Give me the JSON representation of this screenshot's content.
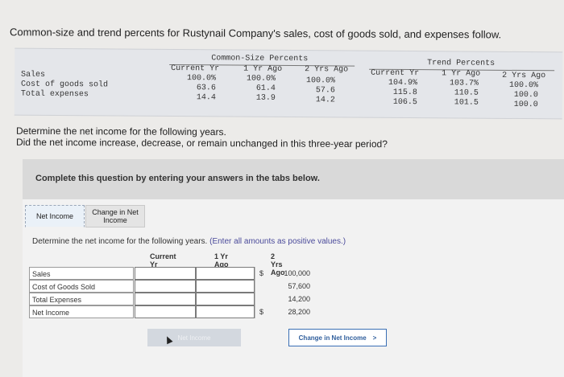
{
  "question": {
    "title": "Common-size and trend percents for Rustynail Company's sales, cost of goods sold, and expenses follow.",
    "instructions": [
      "Determine the net income for the following years.",
      "Did the net income increase, decrease, or remain unchanged in this three-year period?"
    ],
    "complete_banner": "Complete this question by entering your answers in the tabs below."
  },
  "data_table": {
    "common_size_header": "Common-Size Percents",
    "trend_header": "Trend Percents",
    "columns": [
      "Current Yr",
      "1 Yr Ago",
      "2 Yrs Ago"
    ],
    "rows": [
      {
        "label": "Sales",
        "common": [
          "100.0%",
          "100.0%",
          "100.0%"
        ],
        "trend": [
          "104.9%",
          "103.7%",
          "100.0%"
        ]
      },
      {
        "label": "Cost of goods sold",
        "common": [
          "63.6",
          "61.4",
          "57.6"
        ],
        "trend": [
          "115.8",
          "110.5",
          "100.0"
        ]
      },
      {
        "label": "Total expenses",
        "common": [
          "14.4",
          "13.9",
          "14.2"
        ],
        "trend": [
          "106.5",
          "101.5",
          "100.0"
        ]
      }
    ]
  },
  "tabs": [
    "Net Income",
    "Change in Net Income"
  ],
  "panel": {
    "prompt": "Determine the net income for the following years.",
    "prompt_note": "(Enter all amounts as positive values.)",
    "columns": [
      "Current Yr",
      "1 Yr Ago",
      "2 Yrs Ago"
    ],
    "currency": "$",
    "rows": [
      {
        "label": "Sales",
        "two_yrs_ago": "100,000",
        "dollar": "$"
      },
      {
        "label": "Cost of Goods Sold",
        "two_yrs_ago": "57,600",
        "dollar": ""
      },
      {
        "label": "Total Expenses",
        "two_yrs_ago": "14,200",
        "dollar": ""
      },
      {
        "label": "Net Income",
        "two_yrs_ago": "28,200",
        "dollar": "$"
      }
    ]
  },
  "nav": {
    "prev_label": "Net Income",
    "next_label": "Change in Net Income",
    "next_arrow": ">"
  }
}
